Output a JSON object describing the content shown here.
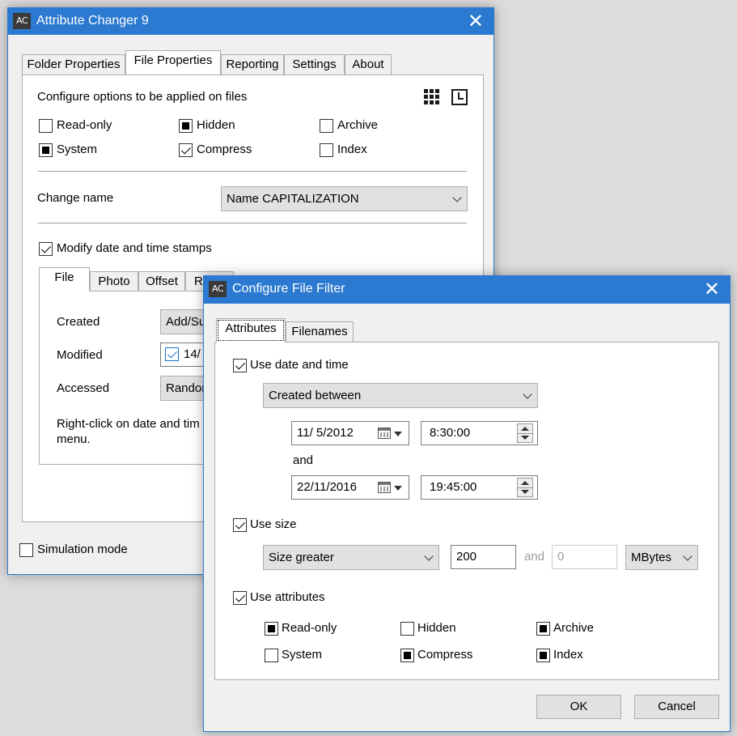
{
  "main_window": {
    "icon_text": "AC",
    "title": "Attribute Changer 9",
    "close_glyph": "✕",
    "tabs": [
      "Folder Properties",
      "File Properties",
      "Reporting",
      "Settings",
      "About"
    ],
    "active_tab": "File Properties",
    "configure_label": "Configure options to be applied on files",
    "icons": [
      "grid-icon",
      "clock-icon"
    ],
    "attributes": [
      {
        "label": "Read-only",
        "state": "unchecked"
      },
      {
        "label": "Hidden",
        "state": "indeterminate"
      },
      {
        "label": "Archive",
        "state": "unchecked"
      },
      {
        "label": "System",
        "state": "indeterminate"
      },
      {
        "label": "Compress",
        "state": "checked"
      },
      {
        "label": "Index",
        "state": "unchecked"
      }
    ],
    "change_name_label": "Change name",
    "change_name_value": "Name CAPITALIZATION",
    "modify_dates_label": "Modify date and time stamps",
    "sub_tabs": [
      "File",
      "Photo",
      "Offset",
      "R"
    ],
    "created_label": "Created",
    "created_value": "Add/Su",
    "modified_label": "Modified",
    "modified_value": "14/",
    "accessed_label": "Accessed",
    "accessed_value": "Randor",
    "hint_line1": "Right-click on date and tim",
    "hint_line2": "menu.",
    "simulation_label": "Simulation mode"
  },
  "filter_dialog": {
    "icon_text": "AC",
    "title": "Configure File Filter",
    "close_glyph": "✕",
    "tabs": [
      "Attributes",
      "Filenames"
    ],
    "active_tab": "Attributes",
    "use_date_label": "Use date and time",
    "date_mode": "Created between",
    "from_date": "11/ 5/2012",
    "from_time": "8:30:00",
    "and_label": "and",
    "to_date": "22/11/2016",
    "to_time": "19:45:00",
    "use_size_label": "Use size",
    "size_mode": "Size greater",
    "size_value": "200",
    "size_and_label": "and",
    "size_value2": "0",
    "size_unit": "MBytes",
    "use_attributes_label": "Use attributes",
    "attributes": [
      {
        "label": "Read-only",
        "state": "indeterminate"
      },
      {
        "label": "Hidden",
        "state": "unchecked"
      },
      {
        "label": "Archive",
        "state": "indeterminate"
      },
      {
        "label": "System",
        "state": "unchecked"
      },
      {
        "label": "Compress",
        "state": "indeterminate"
      },
      {
        "label": "Index",
        "state": "indeterminate"
      }
    ],
    "ok_label": "OK",
    "cancel_label": "Cancel"
  },
  "colors": {
    "titlebar": "#2b79d0",
    "desktop": "#dcdcdc",
    "window_bg": "#f0f0f0",
    "checkbox_blue": "#1f6fd1"
  }
}
